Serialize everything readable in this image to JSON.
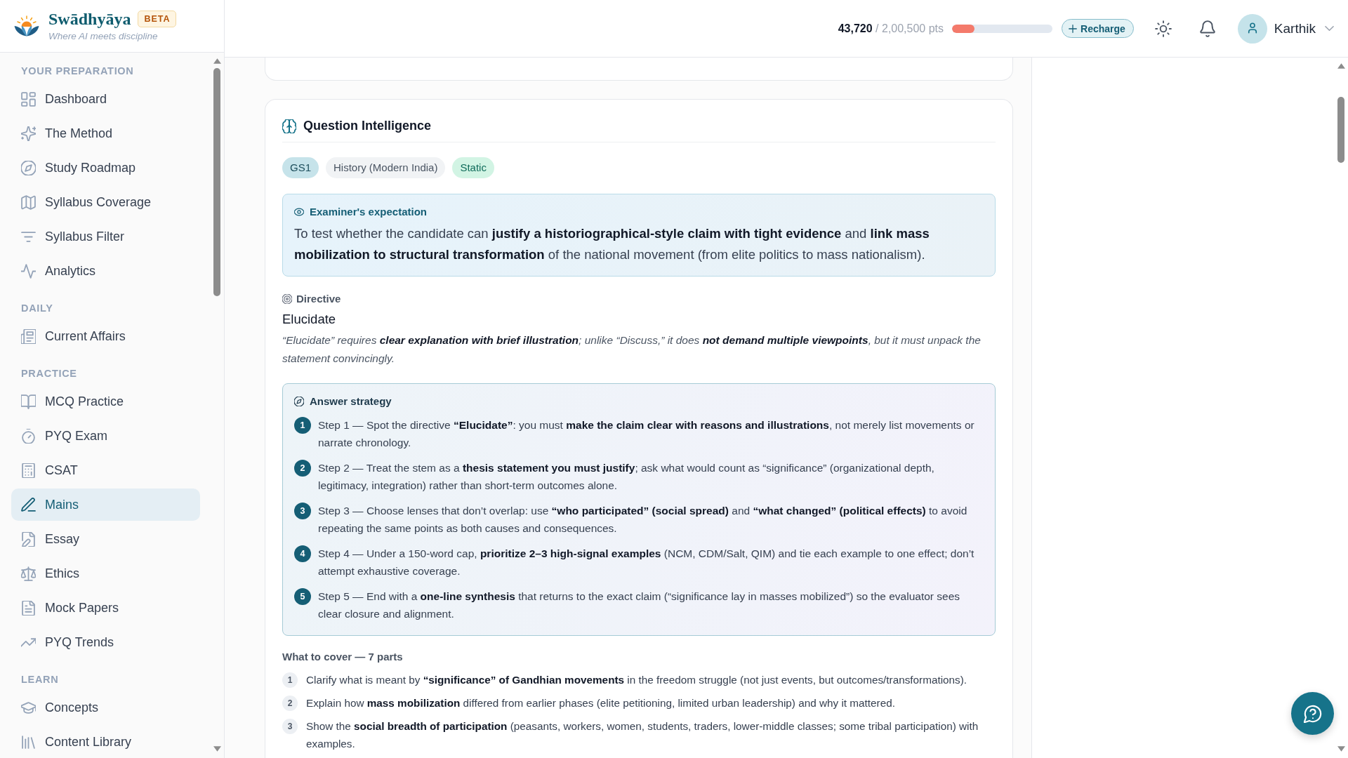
{
  "header": {
    "brand": {
      "name": "Swādhyāya",
      "badge": "BETA",
      "tagline": "Where AI meets discipline"
    },
    "points": {
      "balance": "**43,720** / 2,00,500 pts",
      "level": 0.22
    },
    "recharge_button": "Recharge",
    "user": {
      "name": "Karthik"
    }
  },
  "sidebar": {
    "sections": [
      {
        "title": "YOUR PREPARATION",
        "items": [
          {
            "label": "Dashboard",
            "selected": false
          },
          {
            "label": "The Method",
            "selected": false
          },
          {
            "label": "Study Roadmap",
            "selected": false
          },
          {
            "label": "Syllabus Coverage",
            "selected": false
          },
          {
            "label": "Syllabus Filter",
            "selected": false
          },
          {
            "label": "Analytics",
            "selected": false
          }
        ]
      },
      {
        "title": "DAILY",
        "items": [
          {
            "label": "Current Affairs",
            "selected": false
          }
        ]
      },
      {
        "title": "PRACTICE",
        "items": [
          {
            "label": "MCQ Practice",
            "selected": false
          },
          {
            "label": "PYQ Exam",
            "selected": false
          },
          {
            "label": "CSAT",
            "selected": false
          },
          {
            "label": "Mains",
            "selected": true
          },
          {
            "label": "Essay",
            "selected": false
          },
          {
            "label": "Ethics",
            "selected": false
          },
          {
            "label": "Mock Papers",
            "selected": false
          },
          {
            "label": "PYQ Trends",
            "selected": false
          }
        ]
      },
      {
        "title": "LEARN",
        "items": [
          {
            "label": "Concepts",
            "selected": false
          },
          {
            "label": "Content Library",
            "selected": false
          }
        ]
      }
    ]
  },
  "question_intelligence": {
    "title": "Question Intelligence",
    "tags": [
      {
        "label": "GS1",
        "kind": "paper"
      },
      {
        "label": "History (Modern India)",
        "kind": "subject"
      },
      {
        "label": "Static",
        "kind": "nature"
      }
    ],
    "examiner_expectation": {
      "title": "Examiner's expectation",
      "text": "To test whether the candidate can **justify a historiographical-style claim with tight evidence** and **link mass mobilization to structural transformation** of the national movement (from elite politics to mass nationalism)."
    },
    "directive": {
      "label": "Directive",
      "word": "Elucidate",
      "note": "“Elucidate” requires **clear explanation with brief illustration**; unlike “Discuss,” it does **not demand multiple viewpoints**, but it must unpack the statement convincingly."
    },
    "answer_strategy": {
      "title": "Answer strategy",
      "steps": [
        {
          "number": "1",
          "text": "Step 1 — Spot the directive **“Elucidate”**: you must **make the claim clear with reasons and illustrations**, not merely list movements or narrate chronology."
        },
        {
          "number": "2",
          "text": "Step 2 — Treat the stem as a **thesis statement you must justify**; ask what would count as “significance” (organizational depth, legitimacy, integration) rather than short-term outcomes alone."
        },
        {
          "number": "3",
          "text": "Step 3 — Choose lenses that don’t overlap: use **“who participated” (social spread)** and **“what changed” (political effects)** to avoid repeating the same points as both causes and consequences."
        },
        {
          "number": "4",
          "text": "Step 4 — Under a 150-word cap, **prioritize 2–3 high-signal examples** (NCM, CDM/Salt, QIM) and tie each example to one effect; don’t attempt exhaustive coverage."
        },
        {
          "number": "5",
          "text": "Step 5 — End with a **one-line synthesis** that returns to the exact claim (“significance lay in masses mobilized”) so the evaluator sees clear closure and alignment."
        }
      ]
    },
    "what_to_cover": {
      "title": "What to cover — 7 parts",
      "items": [
        {
          "number": "1",
          "text": "Clarify what is meant by **“significance” of Gandhian movements** in the freedom struggle (not just events, but outcomes/transformations)."
        },
        {
          "number": "2",
          "text": "Explain how **mass mobilization** differed from earlier phases (elite petitioning, limited urban leadership) and why it mattered."
        },
        {
          "number": "3",
          "text": "Show the **social breadth of participation** (peasants, workers, women, students, traders, lower-middle classes; some tribal participation) with examples."
        }
      ]
    }
  }
}
